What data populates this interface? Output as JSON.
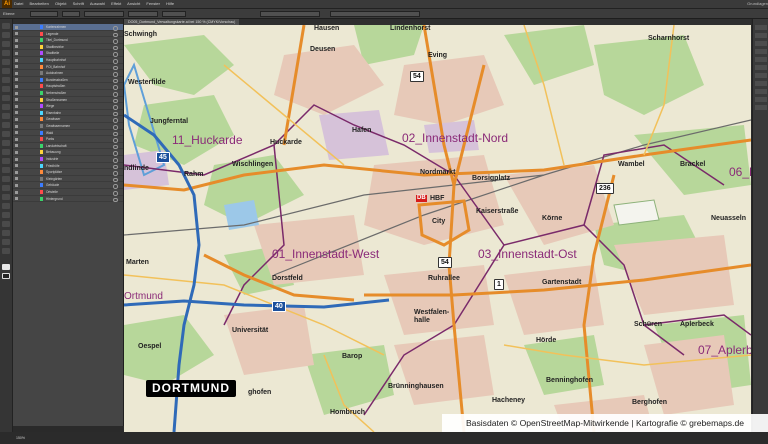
{
  "app": {
    "logo": "Ai",
    "menus": [
      "Datei",
      "Bearbeiten",
      "Objekt",
      "Schrift",
      "Auswahl",
      "Effekt",
      "Ansicht",
      "Fenster",
      "Hilfe"
    ],
    "workspace": "Grundlagen"
  },
  "control_bar": {
    "label": "Ebene"
  },
  "document_tab": {
    "title": "DO05_Dortmund_Verwaltungskarte.ai bei 150 % (CMYK/Vorschau)"
  },
  "layers_panel": {
    "layers": [
      "Kartenrahmen",
      "Legende",
      "Titel_Dortmund",
      "Stadtbezirke",
      "Stadtteile",
      "Hauptbahnhof",
      "POI_Bahnhof",
      "Autobahnen",
      "Bundesstraßen",
      "Hauptstraßen",
      "Nebenstraßen",
      "Straßennamen",
      "Wege",
      "Eisenbahn",
      "Gewässer",
      "Gewässernamen",
      "Wald",
      "Parks",
      "Landwirtschaft",
      "Bebauung",
      "Industrie",
      "Friedhöfe",
      "Sportplätze",
      "Kleingärten",
      "Gebäude",
      "Ortsteile",
      "Hintergrund"
    ],
    "status": "150%"
  },
  "map": {
    "districts": [
      "11_Huckarde",
      "02_Innenstadt-Nord",
      "01_Innenstadt-West",
      "03_Innenstadt-Ost",
      "06_F",
      "07_Aplerb"
    ],
    "places": [
      "Schwingh",
      "Hausen",
      "Lindenhorst",
      "Deusen",
      "Eving",
      "Scharnhorst",
      "Westerfilde",
      "Jungferntal",
      "Huckarde",
      "Hafen",
      "Rahm",
      "Wischlingen",
      "Nordmarkt",
      "Borsigplatz",
      "Wambel",
      "Brackel",
      "Kaiserstraße",
      "Körne",
      "Neuasseln",
      "Marten",
      "City",
      "Dorstfeld",
      "Ruhrallee",
      "Gartenstadt",
      "Universität",
      "Westfalen-halle",
      "Schüren",
      "Oespel",
      "Barop",
      "Hörde",
      "Aplerbeck",
      "Brünninghausen",
      "Hombruch",
      "Hacheney",
      "Benninghofen",
      "Berghofen",
      "Ortmund",
      "ndlinde",
      "ghofen",
      "HBF"
    ],
    "roads": [
      "54",
      "45",
      "40",
      "54",
      "1",
      "236"
    ],
    "title": "DORTMUND",
    "credit": "Basisdaten © OpenStreetMap-Mitwirkende | Kartografie © grebemaps.de"
  }
}
